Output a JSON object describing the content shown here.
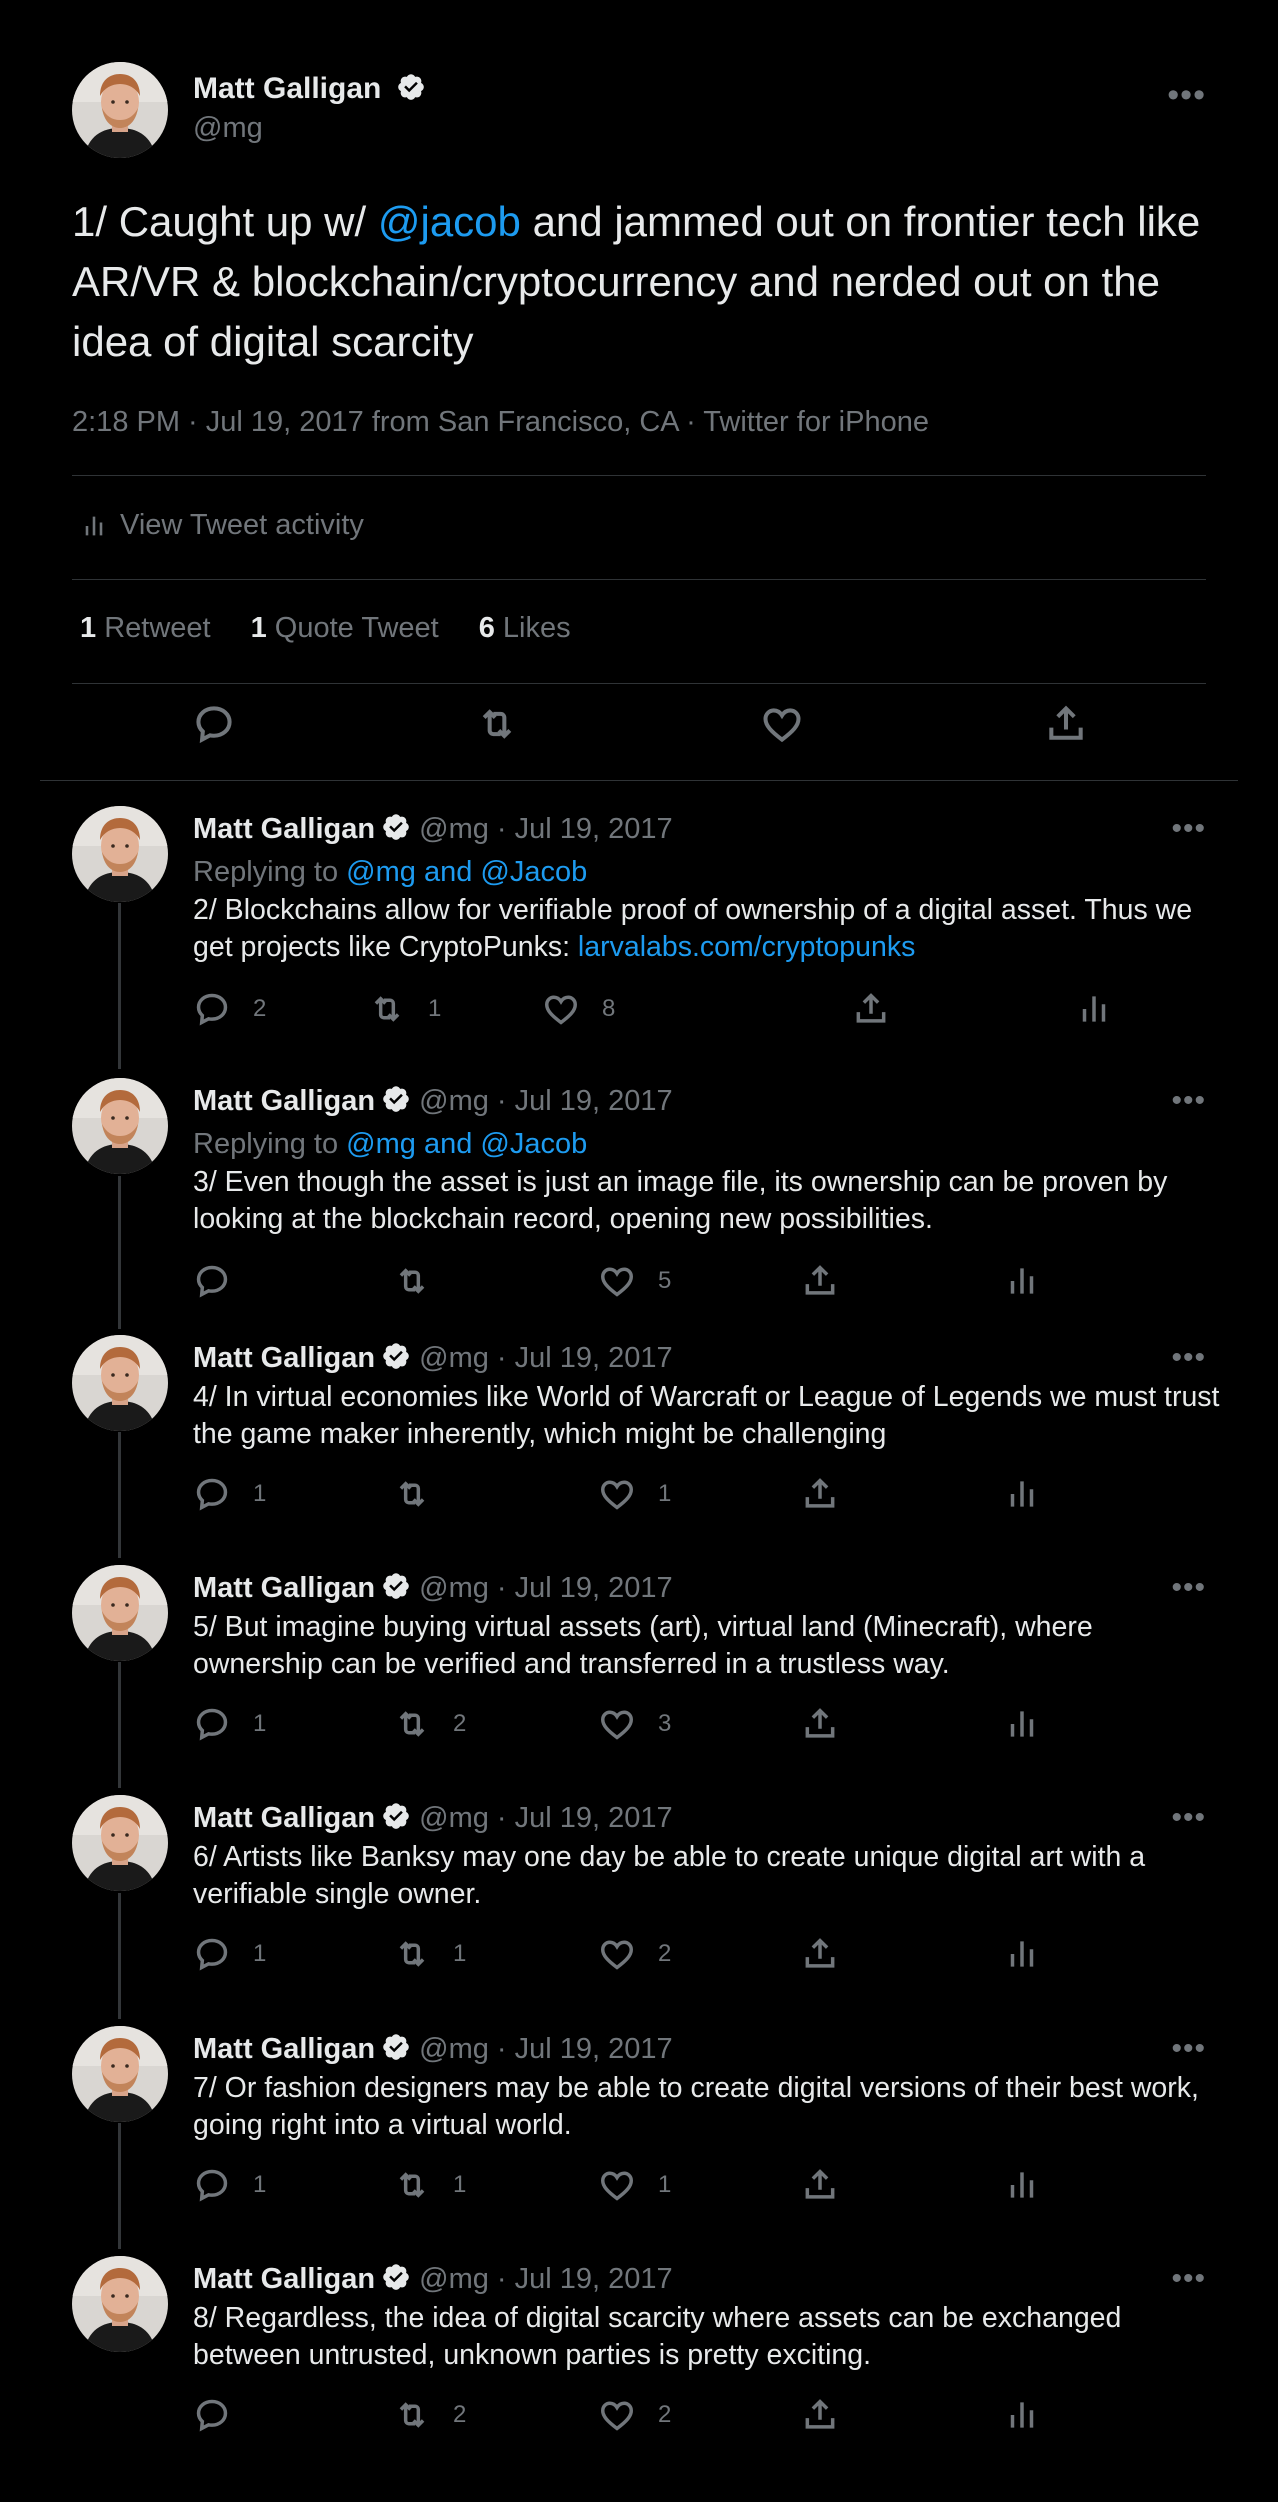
{
  "main_tweet": {
    "author_name": "Matt Galligan",
    "handle": "@mg",
    "text_prefix": "1/ Caught up w/ ",
    "mention": "@jacob",
    "text_suffix": " and jammed out on frontier tech like AR/VR & blockchain/cryptocurrency and nerded out on the idea of digital scarcity",
    "meta": "2:18 PM · Jul 19, 2017 from San Francisco, CA · Twitter for iPhone",
    "activity_label": "View Tweet activity",
    "retweets_count": "1",
    "retweets_label": "Retweet",
    "quotes_count": "1",
    "quotes_label": "Quote Tweet",
    "likes_count": "6",
    "likes_label": "Likes"
  },
  "replies": [
    {
      "name": "Matt Galligan",
      "meta": "@mg · Jul 19, 2017",
      "replying_prefix": "Replying to ",
      "replying_to": "@mg and @Jacob",
      "text": "2/ Blockchains allow for verifiable proof of ownership of a digital asset. Thus we get projects like CryptoPunks: ",
      "link": "larvalabs.com/cryptopunks",
      "reply_count": "2",
      "retweet_count": "1",
      "like_count": "8"
    },
    {
      "name": "Matt Galligan",
      "meta": "@mg · Jul 19, 2017",
      "replying_prefix": "Replying to ",
      "replying_to": "@mg and @Jacob",
      "text": "3/ Even though the asset is just an image file, its ownership can be proven by looking at the blockchain record, opening new possibilities.",
      "reply_count": "",
      "retweet_count": "",
      "like_count": "5"
    },
    {
      "name": "Matt Galligan",
      "meta": "@mg · Jul 19, 2017",
      "text": "4/ In virtual economies like World of Warcraft or League of Legends we must trust the game maker inherently, which might be challenging",
      "reply_count": "1",
      "retweet_count": "",
      "like_count": "1"
    },
    {
      "name": "Matt Galligan",
      "meta": "@mg · Jul 19, 2017",
      "text": "5/ But imagine buying virtual assets (art), virtual land (Minecraft), where ownership can be verified and transferred in a trustless way.",
      "reply_count": "1",
      "retweet_count": "2",
      "like_count": "3"
    },
    {
      "name": "Matt Galligan",
      "meta": "@mg · Jul 19, 2017",
      "text": "6/ Artists like Banksy may one day be able to create unique digital art with a verifiable single owner.",
      "reply_count": "1",
      "retweet_count": "1",
      "like_count": "2"
    },
    {
      "name": "Matt Galligan",
      "meta": "@mg · Jul 19, 2017",
      "text": "7/ Or fashion designers may be able to create digital versions of their best work, going right into a virtual world.",
      "reply_count": "1",
      "retweet_count": "1",
      "like_count": "1"
    },
    {
      "name": "Matt Galligan",
      "meta": "@mg · Jul 19, 2017",
      "text": "8/ Regardless, the idea of digital scarcity where assets can be exchanged between untrusted, unknown parties is pretty exciting.",
      "reply_count": "",
      "retweet_count": "2",
      "like_count": "2"
    }
  ],
  "colors": {
    "background": "#000000",
    "text": "#e7e9ea",
    "secondary": "#71767b",
    "link": "#1d9bf0",
    "divider": "#2f3336"
  },
  "icons": [
    "verified-badge-icon",
    "more-icon",
    "reply-icon",
    "retweet-icon",
    "like-icon",
    "share-icon",
    "analytics-icon",
    "avatar"
  ]
}
